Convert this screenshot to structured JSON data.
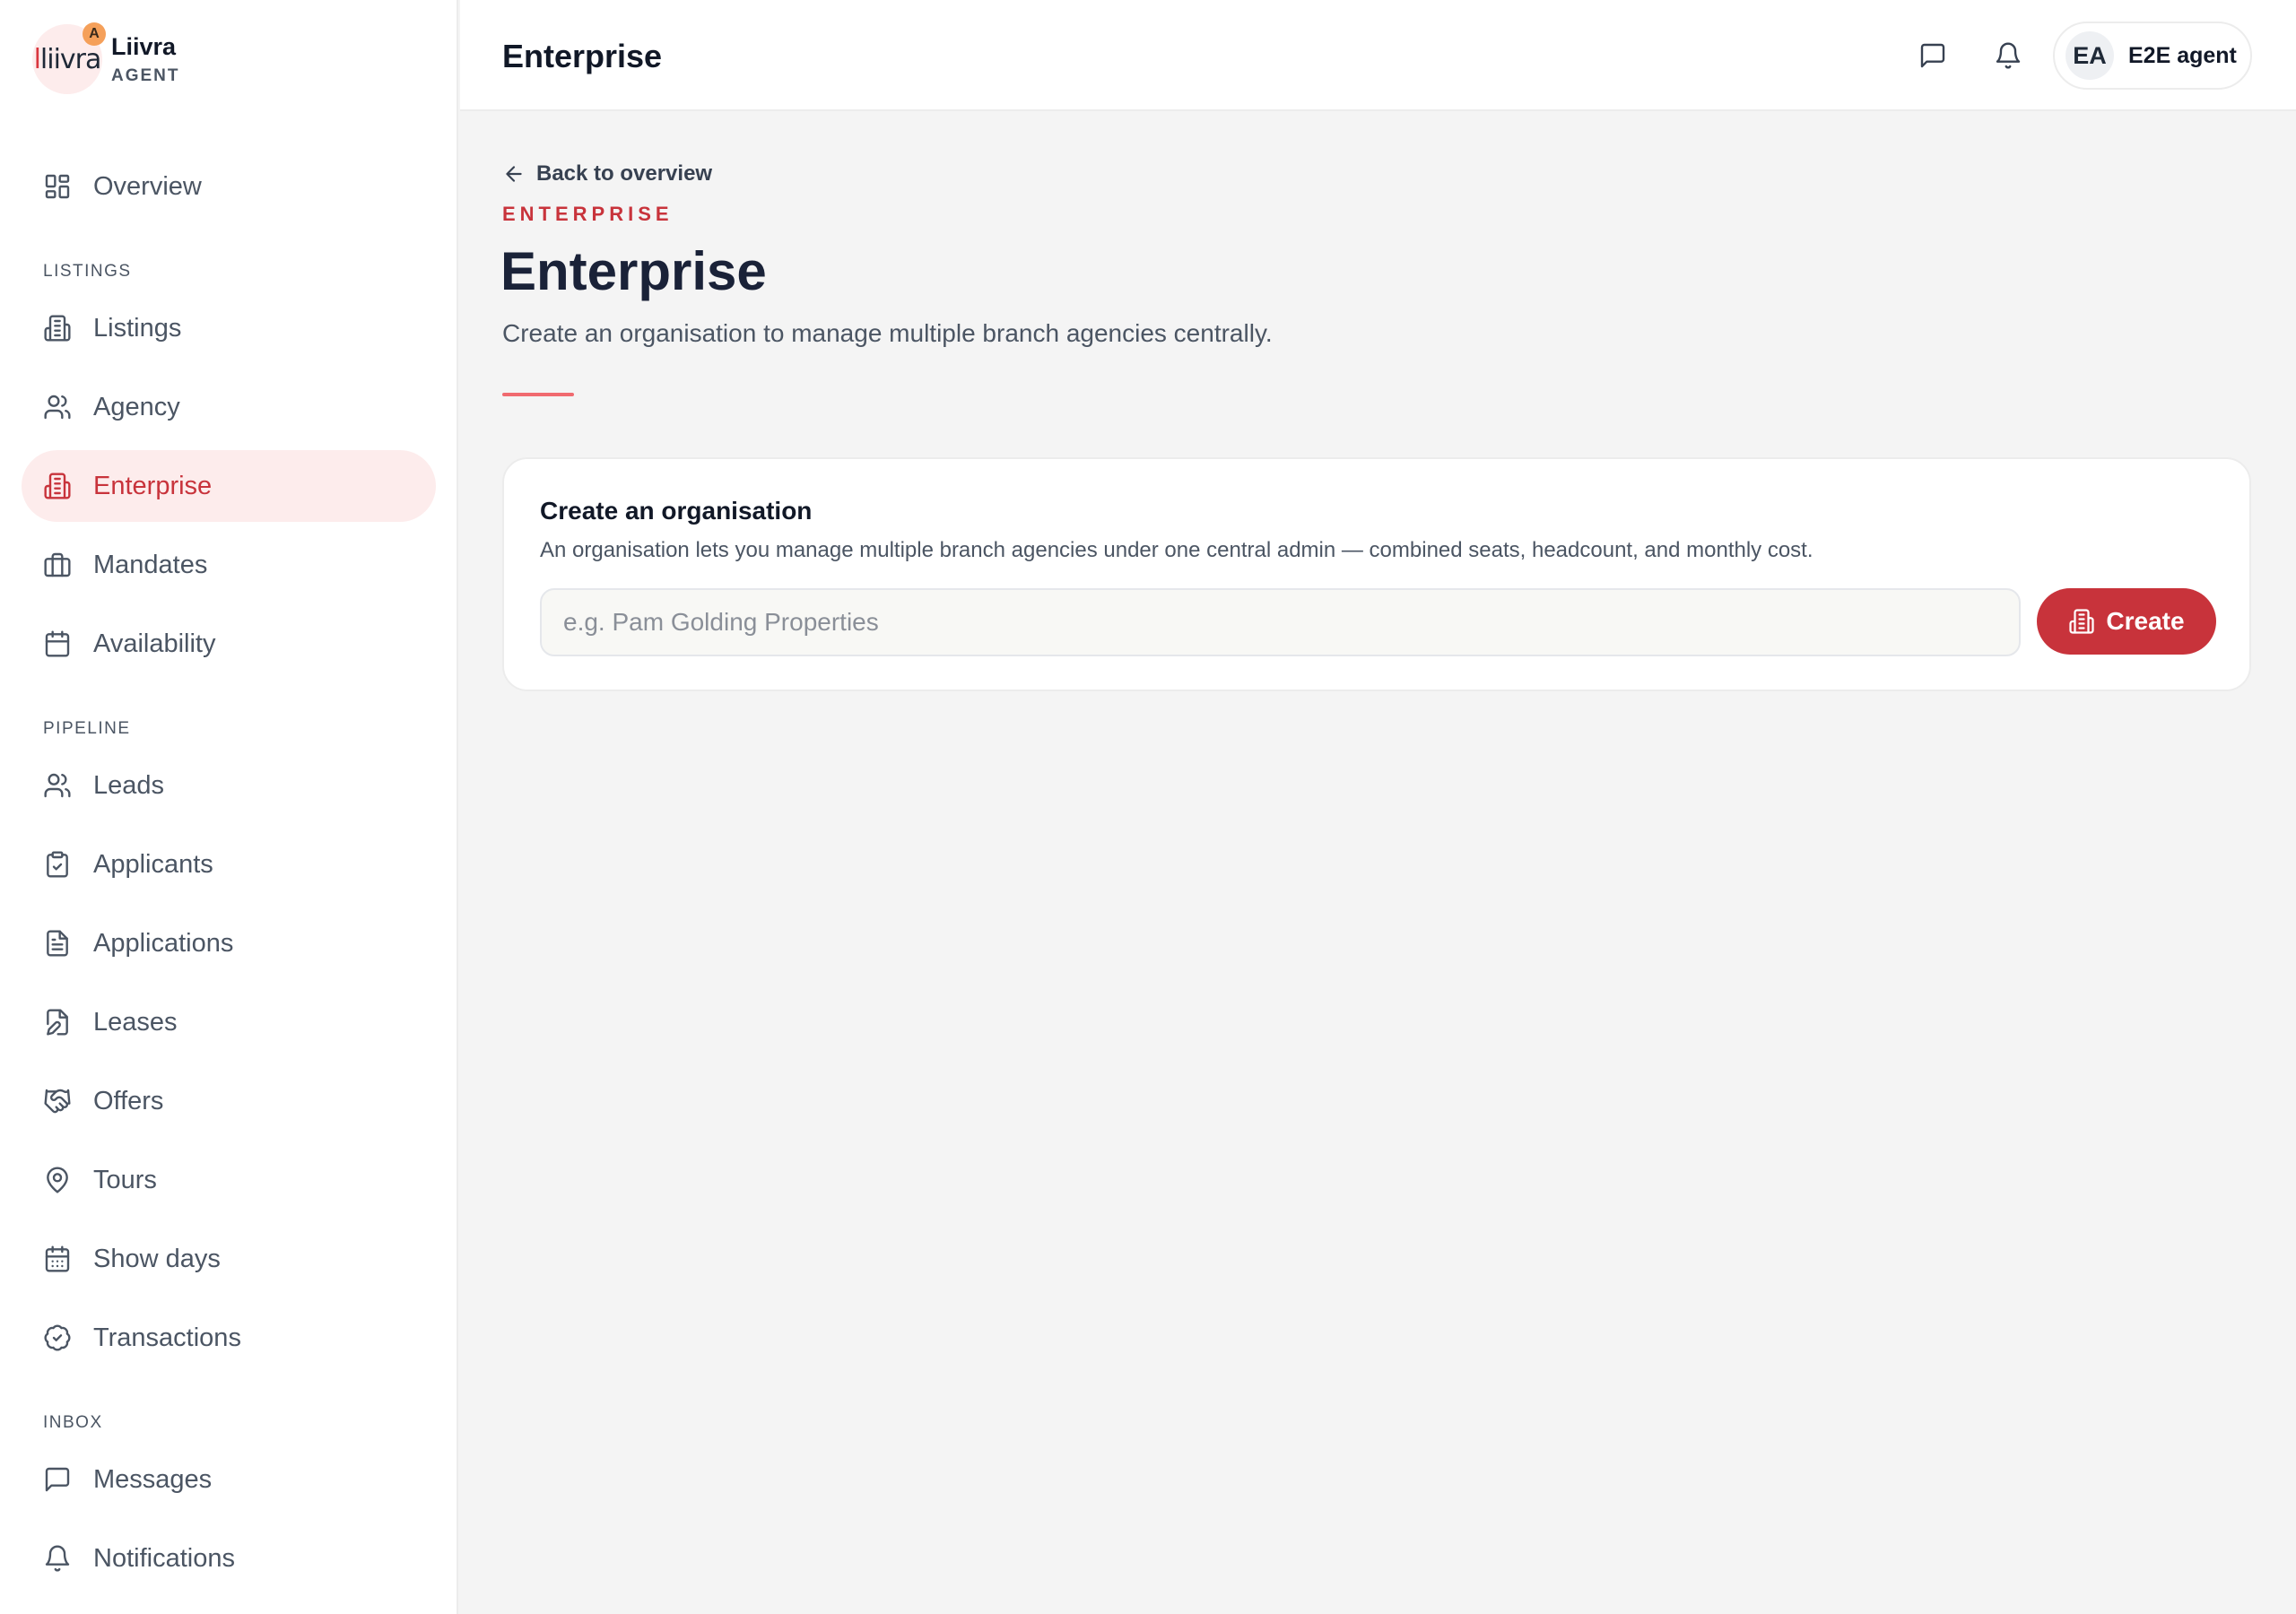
{
  "brand": {
    "logo_text": "liivra",
    "badge": "A",
    "name": "Liivra",
    "role": "AGENT"
  },
  "sidebar": {
    "overview": {
      "label": "Overview",
      "icon": "dashboard-icon"
    },
    "sections": [
      {
        "label": "LISTINGS",
        "items": [
          {
            "label": "Listings",
            "icon": "building-icon"
          },
          {
            "label": "Agency",
            "icon": "users-icon"
          },
          {
            "label": "Enterprise",
            "icon": "building-icon",
            "active": true
          },
          {
            "label": "Mandates",
            "icon": "briefcase-icon"
          },
          {
            "label": "Availability",
            "icon": "calendar-icon"
          }
        ]
      },
      {
        "label": "PIPELINE",
        "items": [
          {
            "label": "Leads",
            "icon": "users-icon"
          },
          {
            "label": "Applicants",
            "icon": "clipboard-check-icon"
          },
          {
            "label": "Applications",
            "icon": "file-text-icon"
          },
          {
            "label": "Leases",
            "icon": "file-edit-icon"
          },
          {
            "label": "Offers",
            "icon": "handshake-icon"
          },
          {
            "label": "Tours",
            "icon": "map-pin-icon"
          },
          {
            "label": "Show days",
            "icon": "calendar-grid-icon"
          },
          {
            "label": "Transactions",
            "icon": "badge-check-icon"
          }
        ]
      },
      {
        "label": "INBOX",
        "items": [
          {
            "label": "Messages",
            "icon": "message-icon"
          },
          {
            "label": "Notifications",
            "icon": "bell-icon"
          }
        ]
      }
    ]
  },
  "header": {
    "title": "Enterprise",
    "user": {
      "initials": "EA",
      "name": "E2E agent"
    }
  },
  "main": {
    "back_link": "Back to overview",
    "eyebrow": "ENTERPRISE",
    "title": "Enterprise",
    "subtitle": "Create an organisation to manage multiple branch agencies centrally.",
    "accent_color": "#f06a6f"
  },
  "card": {
    "title": "Create an organisation",
    "description": "An organisation lets you manage multiple branch agencies under one central admin — combined seats, headcount, and monthly cost.",
    "input": {
      "placeholder": "e.g. Pam Golding Properties",
      "value": ""
    },
    "button_label": "Create",
    "button_color": "#c8333b"
  }
}
